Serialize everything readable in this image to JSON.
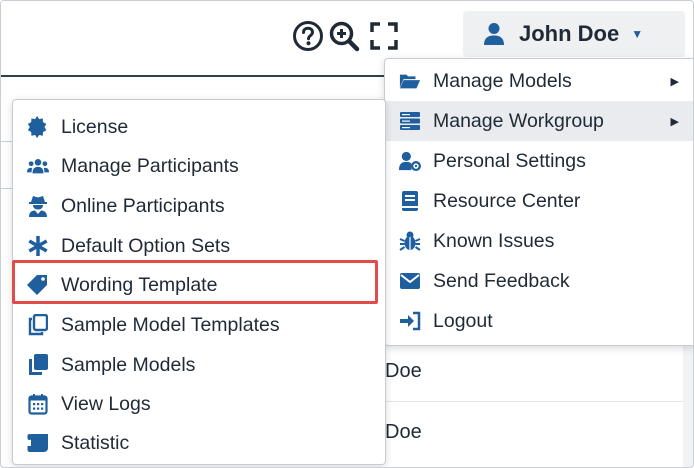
{
  "header": {
    "user_name": "John Doe",
    "icons": [
      "help-icon",
      "search-zoom-icon",
      "fullscreen-icon"
    ]
  },
  "background": {
    "rows": [
      {
        "text": "Doe"
      },
      {
        "text": "Doe"
      }
    ]
  },
  "user_menu": {
    "items": [
      {
        "label": "Manage Models",
        "icon": "folder-open-icon",
        "has_submenu": true
      },
      {
        "label": "Manage Workgroup",
        "icon": "server-icon",
        "has_submenu": true,
        "active": true
      },
      {
        "label": "Personal Settings",
        "icon": "user-cog-icon"
      },
      {
        "label": "Resource Center",
        "icon": "book-icon"
      },
      {
        "label": "Known Issues",
        "icon": "bug-icon"
      },
      {
        "label": "Send Feedback",
        "icon": "envelope-icon"
      },
      {
        "label": "Logout",
        "icon": "sign-out-icon"
      }
    ]
  },
  "workgroup_submenu": {
    "items": [
      {
        "label": "License",
        "icon": "certificate-icon"
      },
      {
        "label": "Manage Participants",
        "icon": "users-icon"
      },
      {
        "label": "Online Participants",
        "icon": "user-secret-icon"
      },
      {
        "label": "Default Option Sets",
        "icon": "asterisk-icon"
      },
      {
        "label": "Wording Template",
        "icon": "tag-icon",
        "highlighted": true
      },
      {
        "label": "Sample Model Templates",
        "icon": "copy-outline-icon"
      },
      {
        "label": "Sample Models",
        "icon": "copy-icon"
      },
      {
        "label": "View Logs",
        "icon": "calendar-icon"
      },
      {
        "label": "Statistic",
        "icon": "scroll-icon"
      }
    ]
  },
  "colors": {
    "accent": "#1f5f9e",
    "text": "#1f2a36",
    "highlight": "#e34a4a",
    "active_bg": "#e9ebee"
  }
}
